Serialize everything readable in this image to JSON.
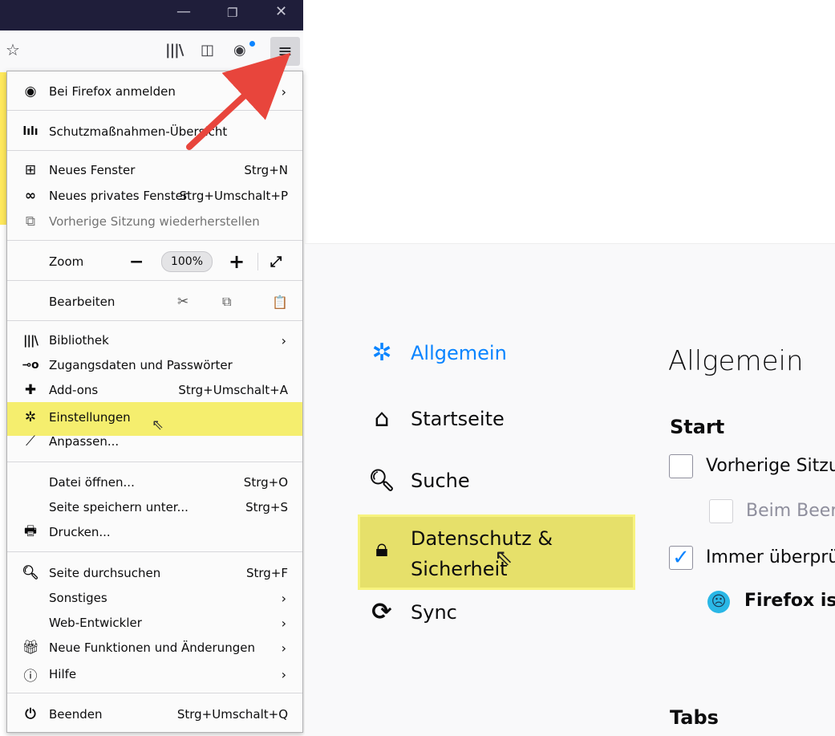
{
  "menu": {
    "items": [
      {
        "label": "Bei Firefox anmelden",
        "shortcut": "",
        "icon": "account-icon",
        "arrow": true
      },
      {
        "label": "Schutzmaßnahmen-Übersicht",
        "shortcut": "",
        "icon": "dashboard-icon"
      },
      {
        "label": "Neues Fenster",
        "shortcut": "Strg+N",
        "icon": "new-window-icon"
      },
      {
        "label": "Neues privates Fenster",
        "shortcut": "Strg+Umschalt+P",
        "icon": "private-mask-icon"
      },
      {
        "label": "Vorherige Sitzung wiederherstellen",
        "shortcut": "",
        "icon": "restore-session-icon"
      },
      {
        "label": "Zoom",
        "zoom_value": "100%"
      },
      {
        "label": "Bearbeiten"
      },
      {
        "label": "Bibliothek",
        "icon": "library-icon",
        "arrow": true
      },
      {
        "label": "Zugangsdaten und Passwörter",
        "icon": "key-icon"
      },
      {
        "label": "Add-ons",
        "shortcut": "Strg+Umschalt+A",
        "icon": "puzzle-icon"
      },
      {
        "label": "Einstellungen",
        "icon": "gear-icon"
      },
      {
        "label": "Anpassen...",
        "icon": "brush-icon"
      },
      {
        "label": "Datei öffnen...",
        "shortcut": "Strg+O"
      },
      {
        "label": "Seite speichern unter...",
        "shortcut": "Strg+S"
      },
      {
        "label": "Drucken...",
        "icon": "printer-icon"
      },
      {
        "label": "Seite durchsuchen",
        "shortcut": "Strg+F",
        "icon": "search-icon"
      },
      {
        "label": "Sonstiges",
        "arrow": true
      },
      {
        "label": "Web-Entwickler",
        "arrow": true
      },
      {
        "label": "Neue Funktionen und Änderungen",
        "icon": "gift-icon",
        "arrow": true
      },
      {
        "label": "Hilfe",
        "icon": "help-icon",
        "arrow": true
      },
      {
        "label": "Beenden",
        "shortcut": "Strg+Umschalt+Q",
        "icon": "power-icon"
      }
    ]
  },
  "prefs": {
    "nav": [
      {
        "label": "Allgemein",
        "icon": "gear-icon",
        "active": true
      },
      {
        "label": "Startseite",
        "icon": "home-icon"
      },
      {
        "label": "Suche",
        "icon": "search-icon"
      },
      {
        "label": "Datenschutz &",
        "label2": "Sicherheit",
        "icon": "lock-icon"
      },
      {
        "label": "Sync",
        "icon": "sync-icon"
      }
    ],
    "title": "Allgemein",
    "section_start": "Start",
    "opt_restore": "Vorherige Sitzu",
    "opt_warn": "Beim Beer",
    "opt_check": "Immer überprü",
    "opt_default": "Firefox ist",
    "section_tabs": "Tabs"
  },
  "colors": {
    "highlight": "#f5ee6e",
    "accent": "#0a84ff",
    "arrow": "#e8453c"
  }
}
